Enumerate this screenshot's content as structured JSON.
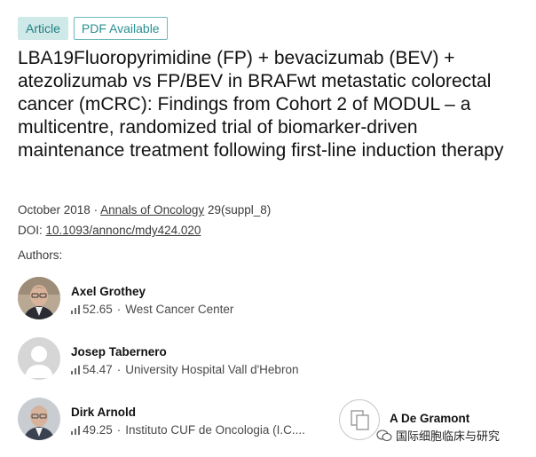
{
  "badges": {
    "article": "Article",
    "pdf": "PDF Available"
  },
  "title": "LBA19Fluoropyrimidine (FP) + bevacizumab (BEV) + atezolizumab vs FP/BEV in BRAFwt metastatic colorectal cancer (mCRC): Findings from Cohort 2 of MODUL – a multicentre, randomized trial of biomarker-driven maintenance treatment following first-line induction therapy",
  "meta": {
    "date": "October 2018",
    "separator": "·",
    "journal": "Annals of Oncology",
    "volume": "29(suppl_8)",
    "doi_label": "DOI:",
    "doi": "10.1093/annonc/mdy424.020"
  },
  "authors_label": "Authors:",
  "authors": [
    {
      "name": "Axel Grothey",
      "score": "52.65",
      "institution": "West Cancer Center",
      "avatar": "photo"
    },
    {
      "name": "Josep Tabernero",
      "score": "54.47",
      "institution": "University Hospital Vall d'Hebron",
      "avatar": "placeholder"
    },
    {
      "name": "Dirk Arnold",
      "score": "49.25",
      "institution": "Instituto CUF de Oncologia (I.C....",
      "avatar": "photo"
    }
  ],
  "corner": {
    "name": "A De Gramont",
    "watermark": "国际细胞临床与研究",
    "icon": "document-copy-icon"
  },
  "colors": {
    "article_badge_bg": "#cfe8e8",
    "badge_text": "#1f7f80",
    "pdf_border": "#6fb8b9"
  }
}
